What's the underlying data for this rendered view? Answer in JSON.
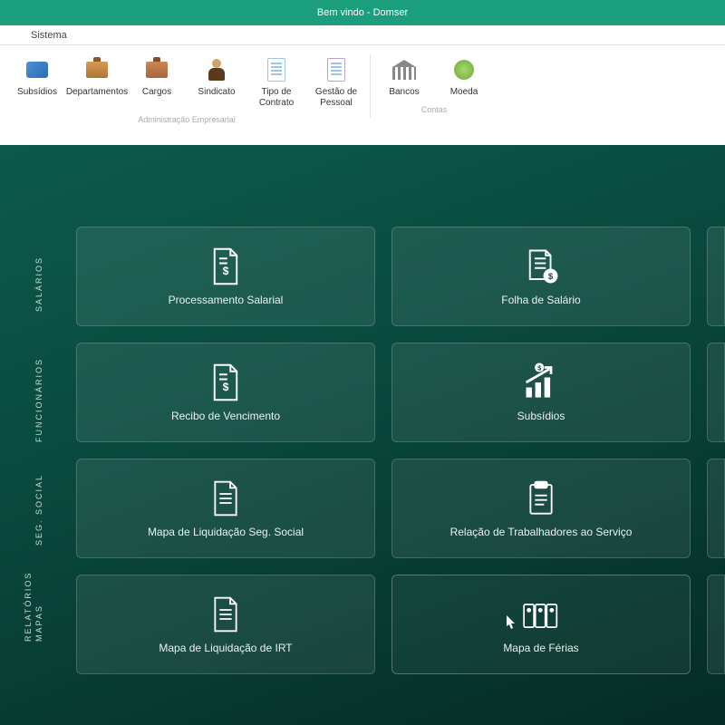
{
  "titlebar": {
    "title": "Bem vindo - Domser"
  },
  "menubar": {
    "item1": "",
    "item2": "Sistema"
  },
  "ribbon": {
    "items": [
      {
        "label": "Subsídios"
      },
      {
        "label": "Departamentos"
      },
      {
        "label": "Cargos"
      },
      {
        "label": "Sindicato"
      },
      {
        "label": "Tipo de Contrato"
      },
      {
        "label": "Gestão de Pessoal"
      },
      {
        "label": "Bancos"
      },
      {
        "label": "Moeda"
      }
    ],
    "group1_label": "Administração Empresarial",
    "group2_label": "Contas"
  },
  "side": {
    "salarios": "SALÁRIOS",
    "funcionarios": "FUNCIONÁRIOS",
    "seg_social": "SEG. SOCIAL",
    "mapas": "MAPAS",
    "relatorios": "RELATÓRIOS"
  },
  "tiles": {
    "r1c1": "Processamento Salarial",
    "r1c2": "Folha de Salário",
    "r2c1": "Recibo de Vencimento",
    "r2c2": "Subsídios",
    "r3c1": "Mapa de Liquidação Seg. Social",
    "r3c2": "Relação de Trabalhadores ao Serviço",
    "r4c1": "Mapa de Liquidação de IRT",
    "r4c2": "Mapa de Férias"
  }
}
